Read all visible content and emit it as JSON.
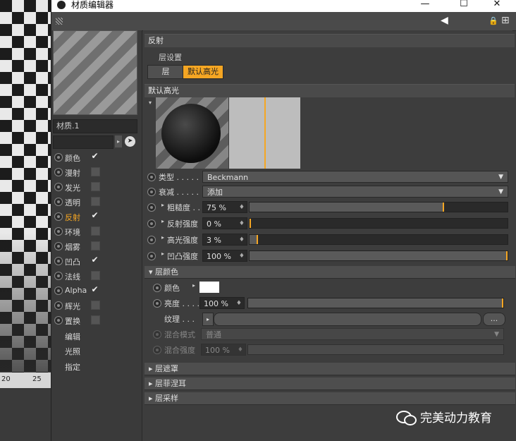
{
  "window": {
    "title": "材质编辑器",
    "minimize": "—",
    "maximize": "☐",
    "close": "✕"
  },
  "toolbar": {
    "back": "◀",
    "lock": "🔒",
    "new": "⊞"
  },
  "timeline": {
    "ticks": [
      "20",
      "25"
    ]
  },
  "left_panel": {
    "material_name": "材质.1",
    "channels": [
      {
        "label": "颜色",
        "checked": true,
        "active": false
      },
      {
        "label": "漫射",
        "checked": false,
        "active": false
      },
      {
        "label": "发光",
        "checked": false,
        "active": false
      },
      {
        "label": "透明",
        "checked": false,
        "active": false
      },
      {
        "label": "反射",
        "checked": true,
        "active": true
      },
      {
        "label": "环境",
        "checked": false,
        "active": false
      },
      {
        "label": "烟雾",
        "checked": false,
        "active": false
      },
      {
        "label": "凹凸",
        "checked": true,
        "active": false
      },
      {
        "label": "法线",
        "checked": false,
        "active": false
      },
      {
        "label": "Alpha",
        "checked": true,
        "active": false
      },
      {
        "label": "辉光",
        "checked": false,
        "active": false
      },
      {
        "label": "置换",
        "checked": false,
        "active": false
      }
    ],
    "links": [
      "编辑",
      "光照",
      "指定"
    ],
    "check_glyph": "✔"
  },
  "main": {
    "section_title": "反射",
    "layer_settings_label": "层设置",
    "tabs": [
      {
        "label": "层",
        "active": false
      },
      {
        "label": "默认高光",
        "active": true
      }
    ],
    "default_hl_title": "默认高光",
    "type": {
      "label": "类型 . . . . .",
      "value": "Beckmann"
    },
    "falloff": {
      "label": "衰减 . . . . .",
      "value": "添加"
    },
    "params": [
      {
        "label": "粗糙度 . .",
        "value": "75 %",
        "fraction": 0.75
      },
      {
        "label": "反射强度",
        "value": "0 %",
        "fraction": 0.0
      },
      {
        "label": "高光强度",
        "value": "3 %",
        "fraction": 0.03
      },
      {
        "label": "凹凸强度",
        "value": "100 %",
        "fraction": 1.0
      }
    ],
    "layer_color": {
      "header": "▾ 层颜色",
      "color_label": "颜色",
      "color_value": "#ffffff",
      "brightness_label": "亮度 . . . .",
      "brightness_value": "100 %",
      "brightness_fraction": 1.0,
      "texture_label": "纹理 . . .",
      "texture_more": "...",
      "blend_mode_label": "混合模式",
      "blend_mode_value": "普通",
      "blend_strength_label": "混合强度",
      "blend_strength_value": "100 %"
    },
    "collapsed_sections": [
      "▸ 层遮罩",
      "▸ 层菲涅耳",
      "▸ 层采样"
    ]
  },
  "watermark": "完美动力教育",
  "colors": {
    "accent": "#f5a623",
    "panel": "#3d3d3d"
  }
}
